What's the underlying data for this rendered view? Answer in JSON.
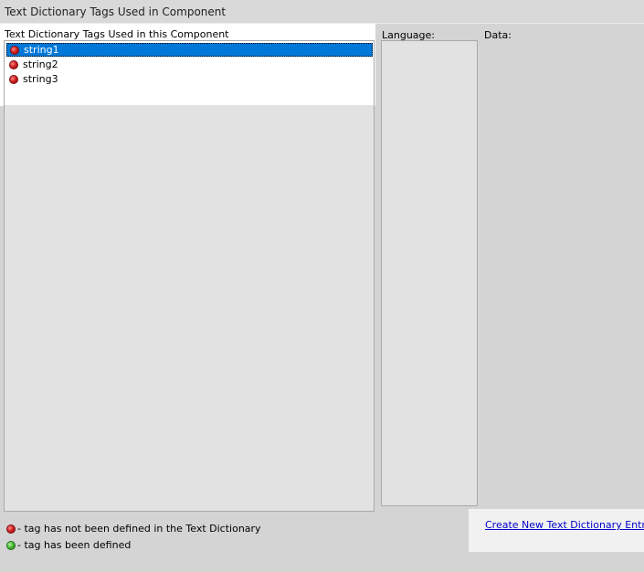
{
  "window": {
    "title": "Text Dictionary Tags Used in Component"
  },
  "tags": {
    "label": "Text Dictionary Tags Used in this Component",
    "items": [
      {
        "label": "string1",
        "status": "not-defined",
        "selected": true
      },
      {
        "label": "string2",
        "status": "not-defined",
        "selected": false
      },
      {
        "label": "string3",
        "status": "not-defined",
        "selected": false
      }
    ]
  },
  "language": {
    "label": "Language:"
  },
  "data": {
    "label": "Data:"
  },
  "legend": {
    "not_defined": "- tag has not been defined in the Text Dictionary",
    "defined": "- tag has been defined"
  },
  "actions": {
    "create_entry": "Create New Text Dictionary Entry"
  },
  "colors": {
    "selection": "#0078d7",
    "status_not_defined": "#d42222",
    "status_defined": "#4bbd35",
    "link": "#0000cc"
  },
  "icons": {
    "not_defined": "red-status-dot-icon",
    "defined": "green-status-dot-icon"
  }
}
